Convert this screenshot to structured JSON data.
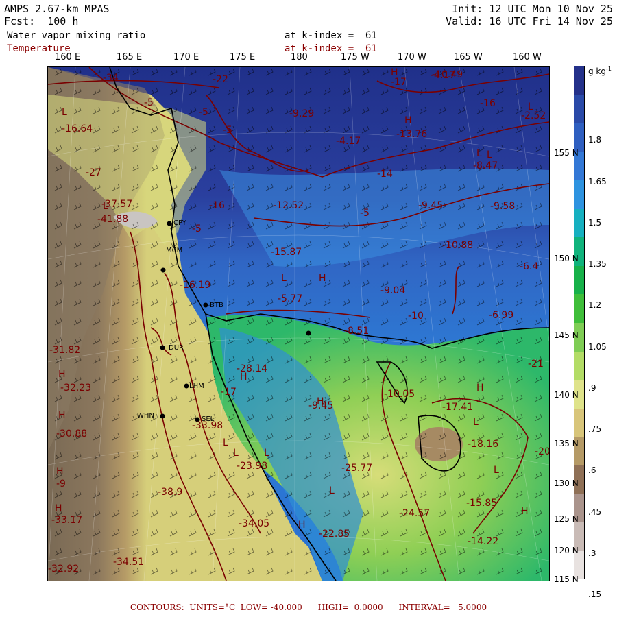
{
  "header": {
    "model": "AMPS 2.67-km MPAS",
    "fcst": "Fcst:  100 h",
    "init": "Init: 12 UTC Mon 10 Nov 25",
    "valid": "Valid: 16 UTC Fri 14 Nov 25",
    "field1": "Water vapor mixing ratio",
    "field1_level": "at k-index =  61",
    "field2": "Temperature",
    "field2_level": "at k-index =  61"
  },
  "longitudes": [
    "160 E",
    "165 E",
    "170 E",
    "175 E",
    "180",
    "175 W",
    "170 W",
    "165 W",
    "160 W"
  ],
  "latitudes": [
    "155",
    "150",
    "145",
    "140",
    "135",
    "130",
    "125",
    "120",
    "115"
  ],
  "colorbar": {
    "unit": "g kg",
    "unit_exp": "-1",
    "labels": [
      "1.8",
      "1.65",
      "1.5",
      "1.35",
      "1.2",
      "1.05",
      ".9",
      ".75",
      ".6",
      ".45",
      ".3",
      ".15"
    ],
    "colors": [
      "#24318a",
      "#2a4aa8",
      "#2f5fc0",
      "#3378d6",
      "#2e93e0",
      "#16b0c0",
      "#10b37c",
      "#17b14a",
      "#3fbe3a",
      "#7fcd55",
      "#b3dc66",
      "#dfe38a",
      "#d8c57a",
      "#b59a66",
      "#8f7056",
      "#aa948c",
      "#c9bbb6",
      "#e8e2e0"
    ]
  },
  "stations": [
    "CPY",
    "MCM",
    "BTB",
    "DUR",
    "LHM",
    "SEL",
    "WHN"
  ],
  "map_labels": {
    "temps": [
      "-34",
      "-22",
      "-17",
      "-5",
      "-5",
      "-5",
      "-9.29",
      "-16.64",
      "-27",
      "-37.57",
      "-41.88",
      "-16",
      "-12.52",
      "-5",
      "-15.87",
      "-10.88",
      "-9.58",
      "-6.4",
      "-9.04",
      "-10",
      "-6.99",
      "-16.19",
      "-5.77",
      "-8.51",
      "-28.14",
      "-17",
      "-31.82",
      "-32.23",
      "-30.88",
      "-9",
      "-33.17",
      "-32.92",
      "-34.51",
      "-38.9",
      "-33.98",
      "-23.98",
      "-34.05",
      "-22.85",
      "-25.77",
      "-24.57",
      "-18.16",
      "-15.85",
      "-14.22",
      "-9.45",
      "-10.05",
      "-17.41",
      "-21",
      "-20",
      "-16",
      "-14",
      "-8.47",
      "-2.52",
      "-13.76",
      "-10.49",
      "-4.17",
      "-9.45",
      "-4.17",
      "-5"
    ],
    "highs_lows": [
      "H",
      "L",
      "H",
      "L",
      "H",
      "L",
      "H",
      "L",
      "H",
      "L",
      "H",
      "L",
      "H",
      "L",
      "H",
      "L",
      "H",
      "L",
      "H",
      "L",
      "H",
      "L",
      "H",
      "L"
    ]
  },
  "footer": "CONTOURS:  UNITS=°C  LOW= -40.000      HIGH=  0.0000      INTERVAL=   5.0000"
}
